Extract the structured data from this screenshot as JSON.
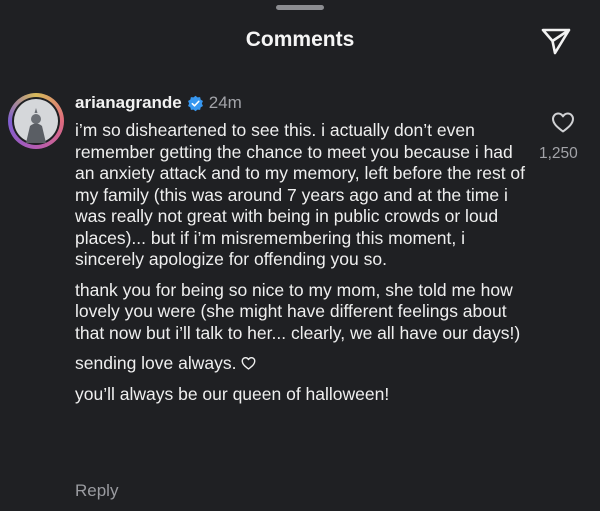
{
  "sheet": {
    "title": "Comments"
  },
  "icons": {
    "share": "paper-plane-icon",
    "verified": "verified-badge-icon",
    "like": "heart-outline-icon"
  },
  "colors": {
    "background": "#1f2023",
    "text": "#f2f2f2",
    "muted": "#a2a3a8",
    "verified": "#3797f0"
  },
  "comment": {
    "username": "arianagrande",
    "time": "24m",
    "paragraphs": [
      "i’m so disheartened to see this. i actually don’t even remember getting the chance to meet you because i had an anxiety attack and to my memory, left before the rest of my family (this was around 7 years ago and at the time i was really not great with being in public crowds or loud places)... but if i’m misremembering this moment, i sincerely apologize for offending you so.",
      "thank you for being so nice to my mom, she told me how lovely you were (she might have different feelings about that now but i’ll talk to her... clearly, we all have our days!)",
      "sending love always.",
      "you’ll always be our queen of halloween!"
    ],
    "reply_label": "Reply",
    "like_count": "1,250"
  }
}
